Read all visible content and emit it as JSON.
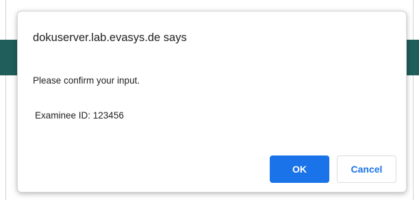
{
  "dialog": {
    "title": "dokuserver.lab.evasys.de says",
    "message": "Please confirm your input.",
    "detail": "Examinee ID: 123456",
    "ok_label": "OK",
    "cancel_label": "Cancel"
  },
  "colors": {
    "accent": "#1a73e8",
    "background_band": "#1f5e5a"
  }
}
